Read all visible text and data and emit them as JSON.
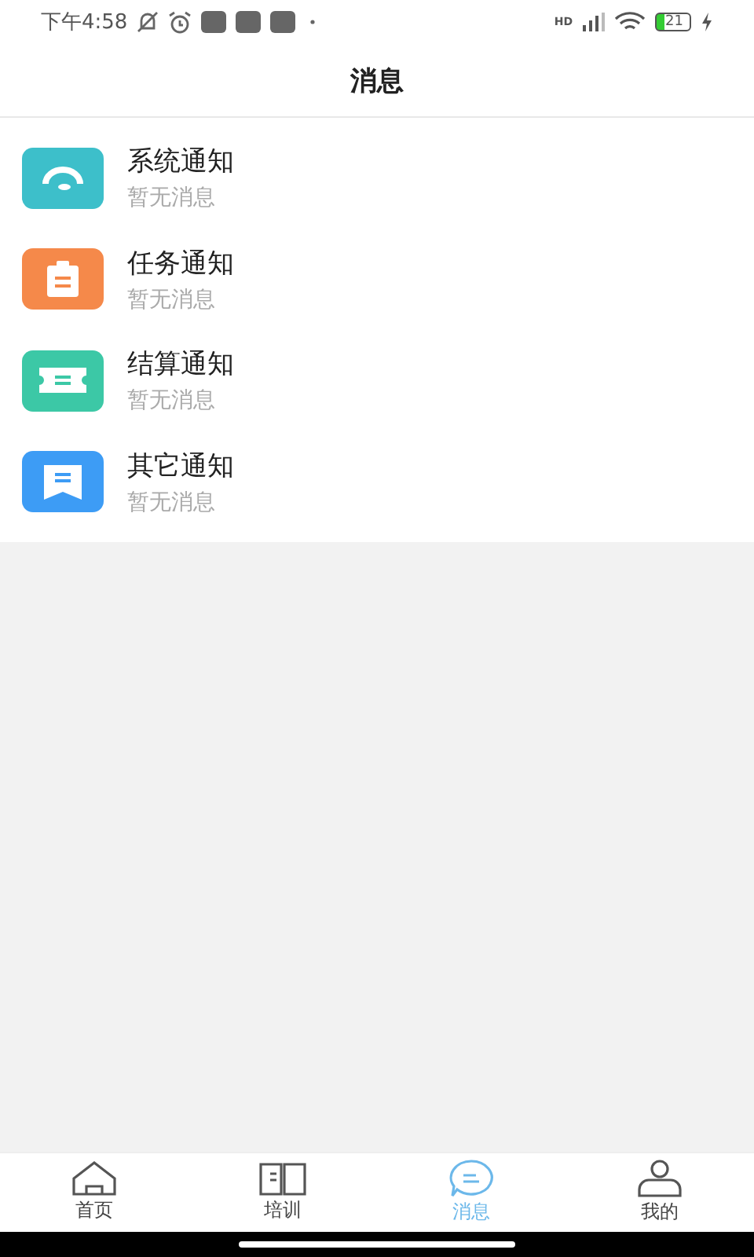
{
  "status_bar": {
    "time": "下午4:58",
    "network": "HD",
    "battery": "21"
  },
  "header": {
    "title": "消息"
  },
  "notifications": [
    {
      "kind": "headset",
      "color": "#3dbfca",
      "title": "系统通知",
      "subtitle": "暂无消息"
    },
    {
      "kind": "clipboard",
      "color": "#f5894a",
      "title": "任务通知",
      "subtitle": "暂无消息"
    },
    {
      "kind": "ticket",
      "color": "#3cc8a6",
      "title": "结算通知",
      "subtitle": "暂无消息"
    },
    {
      "kind": "bookmark",
      "color": "#3d9cf5",
      "title": "其它通知",
      "subtitle": "暂无消息"
    }
  ],
  "tabs": [
    {
      "kind": "home",
      "label": "首页",
      "selected": false
    },
    {
      "kind": "book",
      "label": "培训",
      "selected": false
    },
    {
      "kind": "chat",
      "label": "消息",
      "selected": true
    },
    {
      "kind": "person",
      "label": "我的",
      "selected": false
    }
  ]
}
